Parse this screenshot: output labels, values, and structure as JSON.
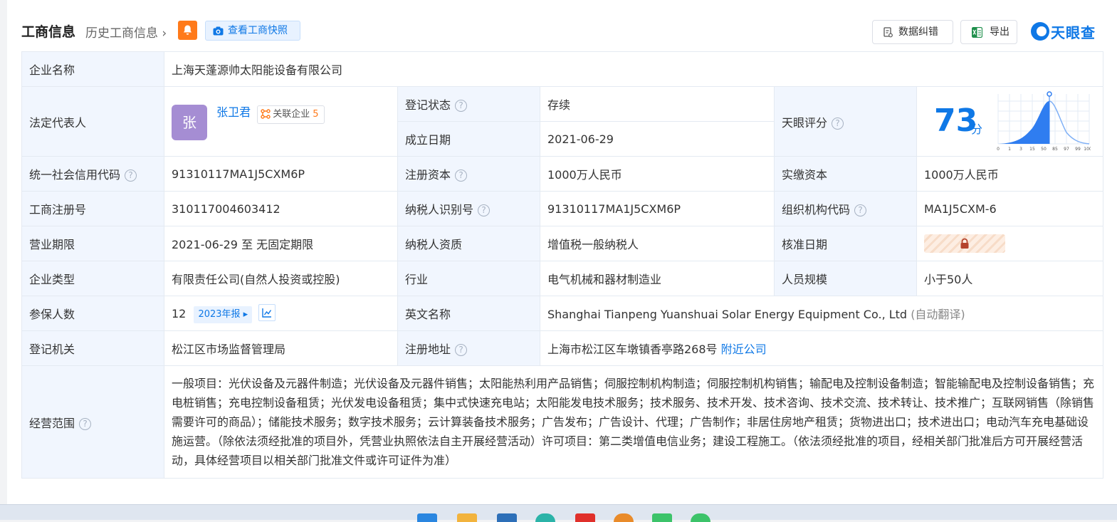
{
  "header": {
    "title": "工商信息",
    "history_link": "历史工商信息",
    "snapshot_label": "查看工商快照",
    "correct_label": "数据纠错",
    "export_label": "导出",
    "logo_text": "天眼查"
  },
  "company": {
    "name_label": "企业名称",
    "name": "上海天蓬源帅太阳能设备有限公司",
    "legal_rep_label": "法定代表人",
    "legal_rep_avatar": "张",
    "legal_rep_name": "张卫君",
    "related_label": "关联企业",
    "related_count": "5",
    "reg_status_label": "登记状态",
    "reg_status": "存续",
    "founded_label": "成立日期",
    "founded": "2021-06-29",
    "score_label": "天眼评分",
    "score": "73",
    "score_unit": "分",
    "score_ticks": [
      "0",
      "1",
      "3",
      "15",
      "50",
      "85",
      "97",
      "99",
      "100"
    ],
    "credit_code_label": "统一社会信用代码",
    "credit_code": "91310117MA1J5CXM6P",
    "reg_capital_label": "注册资本",
    "reg_capital": "1000万人民币",
    "paid_capital_label": "实缴资本",
    "paid_capital": "1000万人民币",
    "reg_no_label": "工商注册号",
    "reg_no": "310117004603412",
    "taxpayer_id_label": "纳税人识别号",
    "taxpayer_id": "91310117MA1J5CXM6P",
    "org_code_label": "组织机构代码",
    "org_code": "MA1J5CXM-6",
    "term_label": "营业期限",
    "term": "2021-06-29 至 无固定期限",
    "taxpayer_qual_label": "纳税人资质",
    "taxpayer_qual": "增值税一般纳税人",
    "approval_date_label": "核准日期",
    "type_label": "企业类型",
    "type": "有限责任公司(自然人投资或控股)",
    "industry_label": "行业",
    "industry": "电气机械和器材制造业",
    "staff_size_label": "人员规模",
    "staff_size": "小于50人",
    "insured_label": "参保人数",
    "insured": "12",
    "annual_report": "2023年报",
    "english_name_label": "英文名称",
    "english_name": "Shanghai Tianpeng Yuanshuai Solar Energy Equipment Co., Ltd",
    "auto_translate": "(自动翻译)",
    "authority_label": "登记机关",
    "authority": "松江区市场监督管理局",
    "address_label": "注册地址",
    "address": "上海市松江区车墩镇香亭路268号",
    "nearby_link": "附近公司",
    "scope_label": "经营范围",
    "scope": "一般项目：光伏设备及元器件制造；光伏设备及元器件销售；太阳能热利用产品销售；伺服控制机构制造；伺服控制机构销售；输配电及控制设备制造；智能输配电及控制设备销售；充电桩销售；充电控制设备租赁；光伏发电设备租赁；集中式快速充电站；太阳能发电技术服务；技术服务、技术开发、技术咨询、技术交流、技术转让、技术推广；互联网销售（除销售需要许可的商品）；储能技术服务；数字技术服务；云计算装备技术服务；广告发布；广告设计、代理；广告制作；非居住房地产租赁；货物进出口；技术进出口；电动汽车充电基础设施运营。（除依法须经批准的项目外，凭营业执照依法自主开展经营活动）许可项目：第二类增值电信业务；建设工程施工。（依法须经批准的项目，经相关部门批准后方可开展经营活动，具体经营项目以相关部门批准文件或许可证件为准）"
  },
  "colors": {
    "accent": "#0f78e6",
    "status_green": "#1a9e51",
    "label_bg": "#f1f6fe",
    "bell_orange": "#ff7a1a"
  }
}
